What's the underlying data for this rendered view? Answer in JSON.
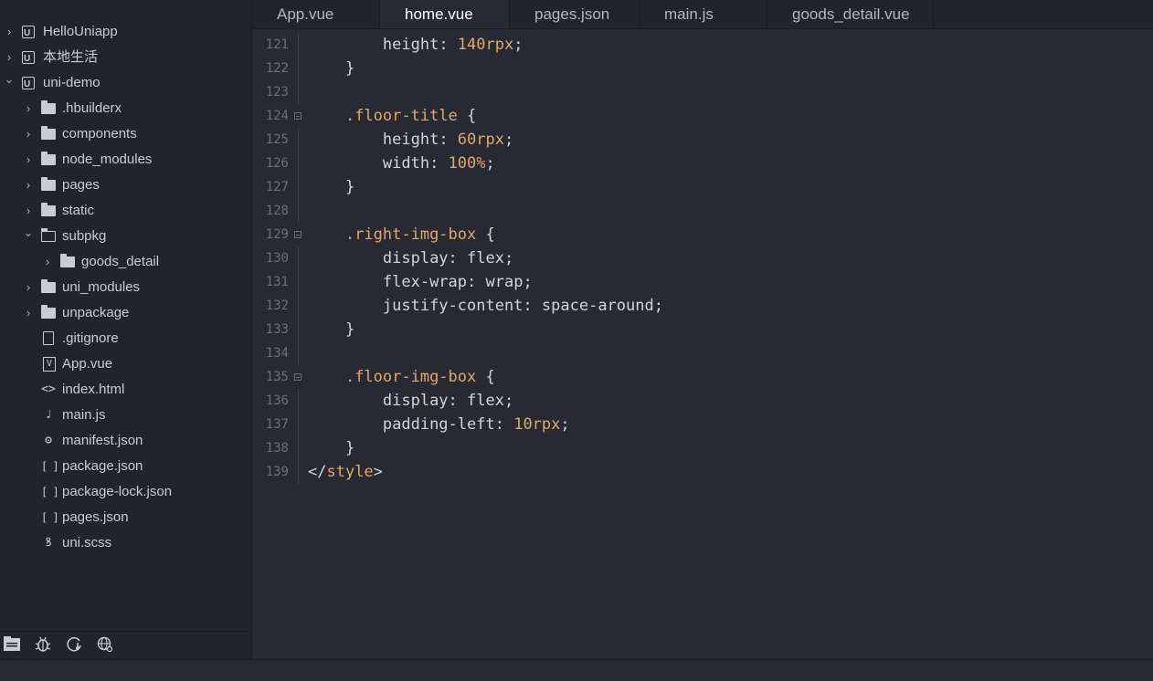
{
  "sidebar": {
    "tree": [
      {
        "label": "HelloUniapp",
        "icon": "project-icon",
        "chevron": "›",
        "depth": 0
      },
      {
        "label": "本地生活",
        "icon": "project-icon",
        "chevron": "›",
        "depth": 0
      },
      {
        "label": "uni-demo",
        "icon": "project-icon",
        "chevron": "⌄",
        "depth": 0
      },
      {
        "label": ".hbuilderx",
        "icon": "folder-icon",
        "chevron": "›",
        "depth": 1
      },
      {
        "label": "components",
        "icon": "folder-icon",
        "chevron": "›",
        "depth": 1
      },
      {
        "label": "node_modules",
        "icon": "folder-icon",
        "chevron": "›",
        "depth": 1
      },
      {
        "label": "pages",
        "icon": "folder-icon",
        "chevron": "›",
        "depth": 1
      },
      {
        "label": "static",
        "icon": "folder-icon",
        "chevron": "›",
        "depth": 1
      },
      {
        "label": "subpkg",
        "icon": "folder-open-icon",
        "chevron": "⌄",
        "depth": 1
      },
      {
        "label": "goods_detail",
        "icon": "folder-icon",
        "chevron": "›",
        "depth": 2
      },
      {
        "label": "uni_modules",
        "icon": "folder-icon",
        "chevron": "›",
        "depth": 1
      },
      {
        "label": "unpackage",
        "icon": "folder-icon",
        "chevron": "›",
        "depth": 1
      },
      {
        "label": ".gitignore",
        "icon": "file-icon",
        "chevron": "",
        "depth": 1
      },
      {
        "label": "App.vue",
        "icon": "vue-file-icon",
        "chevron": "",
        "depth": 1
      },
      {
        "label": "index.html",
        "icon": "html-file-icon",
        "chevron": "",
        "depth": 1
      },
      {
        "label": "main.js",
        "icon": "js-file-icon",
        "chevron": "",
        "depth": 1
      },
      {
        "label": "manifest.json",
        "icon": "manifest-file-icon",
        "chevron": "",
        "depth": 1
      },
      {
        "label": "package.json",
        "icon": "json-file-icon",
        "chevron": "",
        "depth": 1
      },
      {
        "label": "package-lock.json",
        "icon": "json-file-icon",
        "chevron": "",
        "depth": 1
      },
      {
        "label": "pages.json",
        "icon": "json-file-icon",
        "chevron": "",
        "depth": 1
      },
      {
        "label": "uni.scss",
        "icon": "scss-file-icon",
        "chevron": "",
        "depth": 1
      }
    ],
    "footer_icons": [
      "files-icon",
      "debug-icon",
      "git-icon",
      "browser-icon"
    ]
  },
  "tabs": [
    {
      "label": "App.vue",
      "active": false
    },
    {
      "label": "home.vue",
      "active": true
    },
    {
      "label": "pages.json",
      "active": false
    },
    {
      "label": "main.js",
      "active": false
    },
    {
      "label": "goods_detail.vue",
      "active": false
    }
  ],
  "editor": {
    "lines": [
      {
        "n": "121",
        "fold": false,
        "indent": 2,
        "tokens": [
          [
            "prop",
            "height"
          ],
          [
            "colon",
            ": "
          ],
          [
            "num",
            "140rpx"
          ],
          [
            "prop",
            ";"
          ]
        ]
      },
      {
        "n": "122",
        "fold": false,
        "indent": 1,
        "tokens": [
          [
            "brace",
            "}"
          ]
        ]
      },
      {
        "n": "123",
        "fold": false,
        "indent": 0,
        "tokens": []
      },
      {
        "n": "124",
        "fold": true,
        "indent": 1,
        "tokens": [
          [
            "sel",
            ".floor-title"
          ],
          [
            "brace",
            " {"
          ]
        ]
      },
      {
        "n": "125",
        "fold": false,
        "indent": 2,
        "tokens": [
          [
            "prop",
            "height"
          ],
          [
            "colon",
            ": "
          ],
          [
            "num",
            "60rpx"
          ],
          [
            "prop",
            ";"
          ]
        ]
      },
      {
        "n": "126",
        "fold": false,
        "indent": 2,
        "tokens": [
          [
            "prop",
            "width"
          ],
          [
            "colon",
            ": "
          ],
          [
            "num",
            "100%"
          ],
          [
            "prop",
            ";"
          ]
        ]
      },
      {
        "n": "127",
        "fold": false,
        "indent": 1,
        "tokens": [
          [
            "brace",
            "}"
          ]
        ]
      },
      {
        "n": "128",
        "fold": false,
        "indent": 0,
        "tokens": []
      },
      {
        "n": "129",
        "fold": true,
        "indent": 1,
        "tokens": [
          [
            "sel",
            ".right-img-box"
          ],
          [
            "brace",
            " {"
          ]
        ]
      },
      {
        "n": "130",
        "fold": false,
        "indent": 2,
        "tokens": [
          [
            "prop",
            "display"
          ],
          [
            "colon",
            ": "
          ],
          [
            "prop",
            "flex;"
          ]
        ]
      },
      {
        "n": "131",
        "fold": false,
        "indent": 2,
        "tokens": [
          [
            "prop",
            "flex-wrap"
          ],
          [
            "colon",
            ": "
          ],
          [
            "prop",
            "wrap;"
          ]
        ]
      },
      {
        "n": "132",
        "fold": false,
        "indent": 2,
        "tokens": [
          [
            "prop",
            "justify-content"
          ],
          [
            "colon",
            ": "
          ],
          [
            "prop",
            "space-around;"
          ]
        ]
      },
      {
        "n": "133",
        "fold": false,
        "indent": 1,
        "tokens": [
          [
            "brace",
            "}"
          ]
        ]
      },
      {
        "n": "134",
        "fold": false,
        "indent": 0,
        "tokens": []
      },
      {
        "n": "135",
        "fold": true,
        "indent": 1,
        "tokens": [
          [
            "sel",
            ".floor-img-box"
          ],
          [
            "brace",
            " {"
          ]
        ]
      },
      {
        "n": "136",
        "fold": false,
        "indent": 2,
        "tokens": [
          [
            "prop",
            "display"
          ],
          [
            "colon",
            ": "
          ],
          [
            "prop",
            "flex;"
          ]
        ]
      },
      {
        "n": "137",
        "fold": false,
        "indent": 2,
        "tokens": [
          [
            "prop",
            "padding-left"
          ],
          [
            "colon",
            ": "
          ],
          [
            "num",
            "10rpx"
          ],
          [
            "prop",
            ";"
          ]
        ]
      },
      {
        "n": "138",
        "fold": false,
        "indent": 1,
        "tokens": [
          [
            "brace",
            "}"
          ]
        ]
      },
      {
        "n": "139",
        "fold": false,
        "indent": 0,
        "tokens": [
          [
            "brace",
            "</"
          ],
          [
            "tag",
            "style"
          ],
          [
            "brace",
            ">"
          ]
        ]
      }
    ]
  }
}
